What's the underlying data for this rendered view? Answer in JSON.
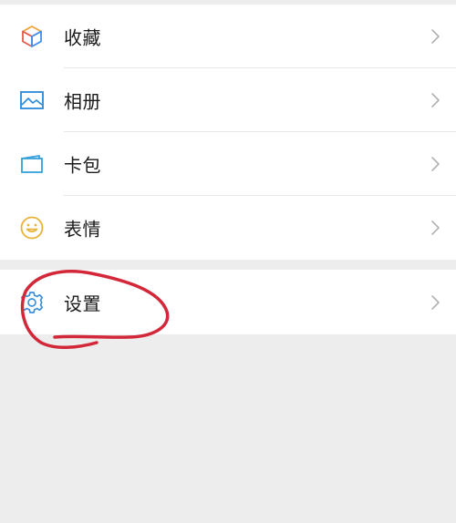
{
  "menu": {
    "items": [
      {
        "label": "收藏",
        "icon": "favorites-cube-icon"
      },
      {
        "label": "相册",
        "icon": "album-picture-icon"
      },
      {
        "label": "卡包",
        "icon": "card-wallet-icon"
      },
      {
        "label": "表情",
        "icon": "emoji-smile-icon"
      }
    ],
    "settings": {
      "label": "设置",
      "icon": "settings-gear-icon"
    }
  },
  "colors": {
    "background": "#ededed",
    "row": "#ffffff",
    "favorites_orange": "#f3a33a",
    "favorites_red": "#e85a50",
    "favorites_blue": "#3f8ff0",
    "album_blue": "#2b89d8",
    "card_blue": "#35a0db",
    "emoji_yellow": "#e8b33a",
    "settings_blue": "#3f8fd8",
    "chevron": "#b2b2b2",
    "annotation_red": "#d2283a"
  }
}
